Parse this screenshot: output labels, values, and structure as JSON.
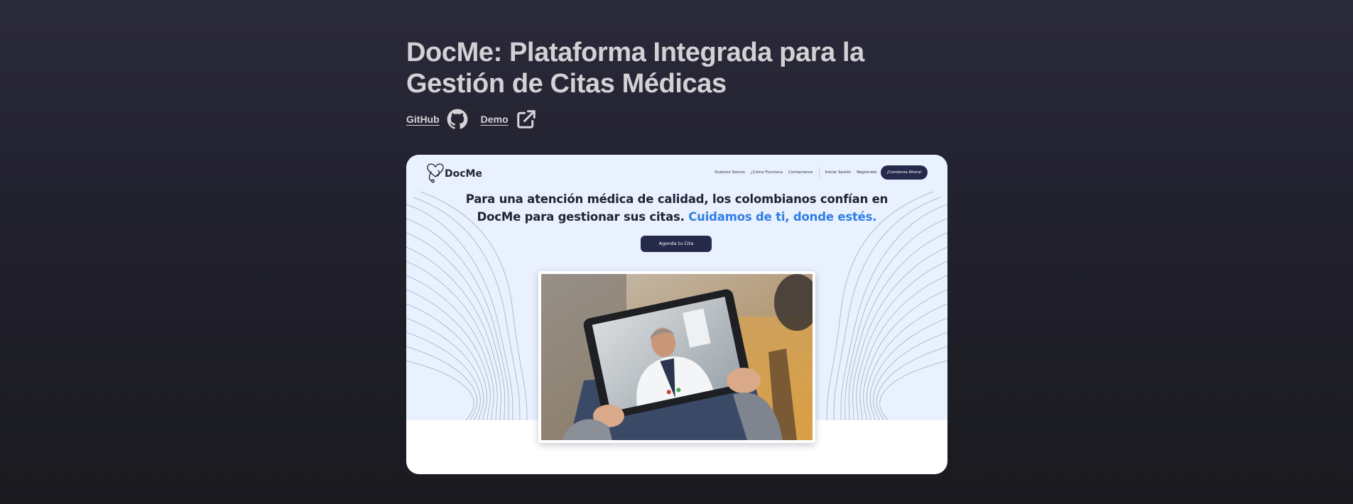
{
  "project": {
    "title": "DocMe: Plataforma Integrada para la Gestión de Citas Médicas",
    "links": [
      {
        "label": "GitHub",
        "icon": "github-icon"
      },
      {
        "label": "Demo",
        "icon": "external-link-icon"
      }
    ]
  },
  "preview": {
    "brand": {
      "name": "DocMe",
      "logo": "heart-stethoscope-logo"
    },
    "nav": {
      "items": [
        "Quienes Somos",
        "¿Como Funciona",
        "Contactanos"
      ],
      "auth": [
        "Iniciar Sesión",
        "Registrate"
      ],
      "cta": "¡Comienza Ahora!"
    },
    "headline": {
      "line1": "Para una atención médica de calidad, los colombianos confían en",
      "line2_prefix": "DocMe para gestionar sus citas.",
      "line2_accent": "Cuidamos de ti, donde estés."
    },
    "hero_button": "Agenda tu Cita",
    "image": "patient-on-video-call-with-doctor-on-tablet"
  },
  "colors": {
    "page_background_top": "#2b2a3a",
    "page_background_bottom": "#1a1a1f",
    "title": "#d2d2d6",
    "hero_background": "#e9f1ff",
    "brand_dark": "#262a4a",
    "accent_blue": "#2f7ee6"
  }
}
